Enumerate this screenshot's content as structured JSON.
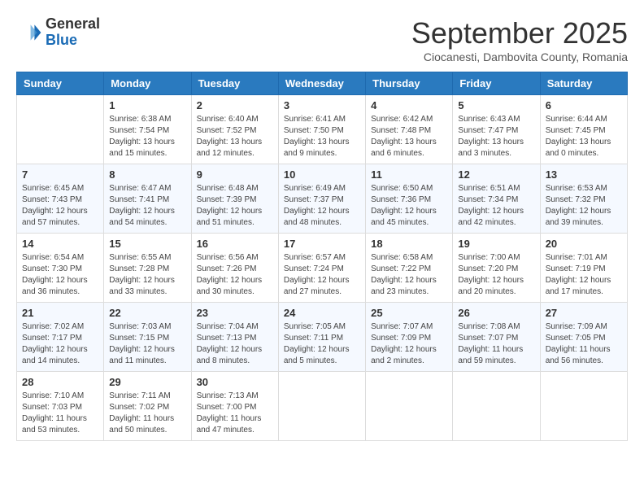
{
  "logo": {
    "general": "General",
    "blue": "Blue"
  },
  "header": {
    "month": "September 2025",
    "location": "Ciocanesti, Dambovita County, Romania"
  },
  "days_of_week": [
    "Sunday",
    "Monday",
    "Tuesday",
    "Wednesday",
    "Thursday",
    "Friday",
    "Saturday"
  ],
  "weeks": [
    [
      {
        "day": "",
        "info": ""
      },
      {
        "day": "1",
        "info": "Sunrise: 6:38 AM\nSunset: 7:54 PM\nDaylight: 13 hours\nand 15 minutes."
      },
      {
        "day": "2",
        "info": "Sunrise: 6:40 AM\nSunset: 7:52 PM\nDaylight: 13 hours\nand 12 minutes."
      },
      {
        "day": "3",
        "info": "Sunrise: 6:41 AM\nSunset: 7:50 PM\nDaylight: 13 hours\nand 9 minutes."
      },
      {
        "day": "4",
        "info": "Sunrise: 6:42 AM\nSunset: 7:48 PM\nDaylight: 13 hours\nand 6 minutes."
      },
      {
        "day": "5",
        "info": "Sunrise: 6:43 AM\nSunset: 7:47 PM\nDaylight: 13 hours\nand 3 minutes."
      },
      {
        "day": "6",
        "info": "Sunrise: 6:44 AM\nSunset: 7:45 PM\nDaylight: 13 hours\nand 0 minutes."
      }
    ],
    [
      {
        "day": "7",
        "info": "Sunrise: 6:45 AM\nSunset: 7:43 PM\nDaylight: 12 hours\nand 57 minutes."
      },
      {
        "day": "8",
        "info": "Sunrise: 6:47 AM\nSunset: 7:41 PM\nDaylight: 12 hours\nand 54 minutes."
      },
      {
        "day": "9",
        "info": "Sunrise: 6:48 AM\nSunset: 7:39 PM\nDaylight: 12 hours\nand 51 minutes."
      },
      {
        "day": "10",
        "info": "Sunrise: 6:49 AM\nSunset: 7:37 PM\nDaylight: 12 hours\nand 48 minutes."
      },
      {
        "day": "11",
        "info": "Sunrise: 6:50 AM\nSunset: 7:36 PM\nDaylight: 12 hours\nand 45 minutes."
      },
      {
        "day": "12",
        "info": "Sunrise: 6:51 AM\nSunset: 7:34 PM\nDaylight: 12 hours\nand 42 minutes."
      },
      {
        "day": "13",
        "info": "Sunrise: 6:53 AM\nSunset: 7:32 PM\nDaylight: 12 hours\nand 39 minutes."
      }
    ],
    [
      {
        "day": "14",
        "info": "Sunrise: 6:54 AM\nSunset: 7:30 PM\nDaylight: 12 hours\nand 36 minutes."
      },
      {
        "day": "15",
        "info": "Sunrise: 6:55 AM\nSunset: 7:28 PM\nDaylight: 12 hours\nand 33 minutes."
      },
      {
        "day": "16",
        "info": "Sunrise: 6:56 AM\nSunset: 7:26 PM\nDaylight: 12 hours\nand 30 minutes."
      },
      {
        "day": "17",
        "info": "Sunrise: 6:57 AM\nSunset: 7:24 PM\nDaylight: 12 hours\nand 27 minutes."
      },
      {
        "day": "18",
        "info": "Sunrise: 6:58 AM\nSunset: 7:22 PM\nDaylight: 12 hours\nand 23 minutes."
      },
      {
        "day": "19",
        "info": "Sunrise: 7:00 AM\nSunset: 7:20 PM\nDaylight: 12 hours\nand 20 minutes."
      },
      {
        "day": "20",
        "info": "Sunrise: 7:01 AM\nSunset: 7:19 PM\nDaylight: 12 hours\nand 17 minutes."
      }
    ],
    [
      {
        "day": "21",
        "info": "Sunrise: 7:02 AM\nSunset: 7:17 PM\nDaylight: 12 hours\nand 14 minutes."
      },
      {
        "day": "22",
        "info": "Sunrise: 7:03 AM\nSunset: 7:15 PM\nDaylight: 12 hours\nand 11 minutes."
      },
      {
        "day": "23",
        "info": "Sunrise: 7:04 AM\nSunset: 7:13 PM\nDaylight: 12 hours\nand 8 minutes."
      },
      {
        "day": "24",
        "info": "Sunrise: 7:05 AM\nSunset: 7:11 PM\nDaylight: 12 hours\nand 5 minutes."
      },
      {
        "day": "25",
        "info": "Sunrise: 7:07 AM\nSunset: 7:09 PM\nDaylight: 12 hours\nand 2 minutes."
      },
      {
        "day": "26",
        "info": "Sunrise: 7:08 AM\nSunset: 7:07 PM\nDaylight: 11 hours\nand 59 minutes."
      },
      {
        "day": "27",
        "info": "Sunrise: 7:09 AM\nSunset: 7:05 PM\nDaylight: 11 hours\nand 56 minutes."
      }
    ],
    [
      {
        "day": "28",
        "info": "Sunrise: 7:10 AM\nSunset: 7:03 PM\nDaylight: 11 hours\nand 53 minutes."
      },
      {
        "day": "29",
        "info": "Sunrise: 7:11 AM\nSunset: 7:02 PM\nDaylight: 11 hours\nand 50 minutes."
      },
      {
        "day": "30",
        "info": "Sunrise: 7:13 AM\nSunset: 7:00 PM\nDaylight: 11 hours\nand 47 minutes."
      },
      {
        "day": "",
        "info": ""
      },
      {
        "day": "",
        "info": ""
      },
      {
        "day": "",
        "info": ""
      },
      {
        "day": "",
        "info": ""
      }
    ]
  ]
}
